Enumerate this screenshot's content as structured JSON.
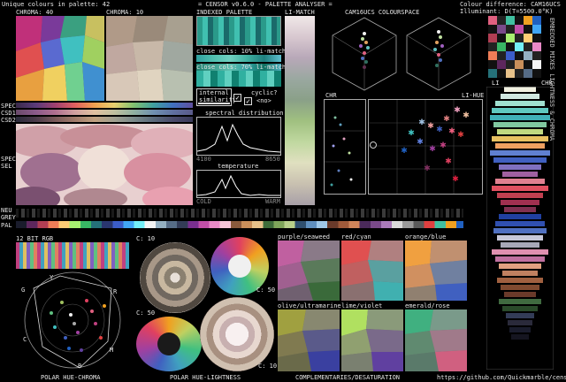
{
  "header": {
    "unique_colours_label": "Unique colours in palette: 42",
    "app_title": "= CENSOR v0.6.0 - PALETTE ANALYSER =",
    "colour_difference_label": "Colour difference: CAM16UCS",
    "illuminant_label": "Illuminant: D(T=5500.0°K)"
  },
  "sections": {
    "chroma_40": "CHROMA: 40",
    "chroma_10": "CHROMA: 10",
    "indexed_palette": "INDEXED PALETTE",
    "li_match": "LI-MATCH",
    "cam16ucs_colourspace": "CAM16UCS COLOURSPACE",
    "chr": "CHR",
    "li_hue": "LI-HUE",
    "li": "LI",
    "chr_right": "CHR",
    "spec": "SPEC",
    "csd1": "CSD1",
    "csd2": "CSD2",
    "spec_sel": "SPEC\nSEL",
    "neu_grey": "NEU\nGREY",
    "pal": "PAL",
    "bit12_rgb": "12 BIT RGB",
    "c10_a": "C: 10",
    "c50_a": "C: 50",
    "c50_b": "C: 50",
    "c10_b": "C: 10",
    "footer_polar_hue_chroma": "POLAR HUE-CHROMA",
    "footer_polar_hue_lightness": "POLAR HUE-LIGHTNESS",
    "footer_complementaries": "COMPLEMENTARIES/DESATURATION",
    "github_link": "https://github.com/Quickmarble/censor",
    "sidebar_vertical": "EMBEDDED MIXES LIGHTNESS & CHROMA"
  },
  "indexed_panel": {
    "close_cols_10": "close cols: 10% li-match",
    "close_cols_70": "close cols: 70% li-match",
    "internal_similarity": "internal\nsimilarity",
    "cyclic": "cyclic?",
    "cyclic_value": "<no>",
    "spectral_distribution": "spectral distribution",
    "spec_min": "4100",
    "spec_max": "8650",
    "temperature": "temperature",
    "temp_cold": "COLD",
    "temp_warm": "WARM"
  },
  "complementaries": [
    {
      "label": "purple/seaweed"
    },
    {
      "label": "red/cyan"
    },
    {
      "label": "orange/blue"
    },
    {
      "label": "olive/ultramarine"
    },
    {
      "label": "lime/violet"
    },
    {
      "label": "emerald/rose"
    }
  ],
  "hue_chroma_axis": {
    "g": "G",
    "y": "Y",
    "r": "R",
    "c": "C",
    "m": "M",
    "b": "B"
  },
  "palette": [
    "#1a1c2c",
    "#5d275d",
    "#b13e53",
    "#ef7d57",
    "#ffcd75",
    "#a7f070",
    "#38b764",
    "#257179",
    "#29366f",
    "#3b5dc9",
    "#41a6f6",
    "#73eff7",
    "#f4f4f4",
    "#94b0c2",
    "#566c86",
    "#333c57",
    "#7a2f8f",
    "#c24fa8",
    "#e98ac7",
    "#f7c6d9",
    "#8a5a3c",
    "#c98f5a",
    "#e8c28a",
    "#3f6d3a",
    "#7fa65a",
    "#b8d08a",
    "#2f4f6f",
    "#5f8fbf",
    "#9fc7e7",
    "#6a3a2a",
    "#a05a3a",
    "#d0855a",
    "#4a2a5a",
    "#7a4a8a",
    "#aa7aba",
    "#dadada",
    "#9a9a9a",
    "#5a5a5a",
    "#e04040",
    "#40c0a0",
    "#f0a020",
    "#2060c0"
  ]
}
